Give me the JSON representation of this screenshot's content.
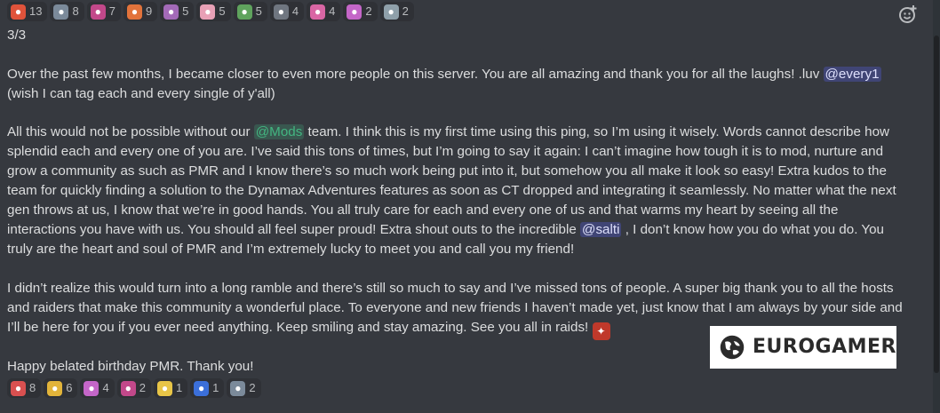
{
  "reactions_top": [
    {
      "emoji": "angry-face-icon",
      "count": "13",
      "color": "#e0533b"
    },
    {
      "emoji": "ghost-pokemon-icon",
      "count": "8",
      "color": "#7b8a9a"
    },
    {
      "emoji": "dragon-pokemon-icon",
      "count": "7",
      "color": "#c2488a"
    },
    {
      "emoji": "fire-pokemon-icon",
      "count": "9",
      "color": "#e2733b"
    },
    {
      "emoji": "bird-pokemon-icon",
      "count": "5",
      "color": "#a36ab8"
    },
    {
      "emoji": "fairy-pokemon-icon",
      "count": "5",
      "color": "#e8a0b6"
    },
    {
      "emoji": "bug-pokemon-icon",
      "count": "5",
      "color": "#5fa35d"
    },
    {
      "emoji": "heart-outline-icon",
      "count": "4",
      "color": "#6f7680"
    },
    {
      "emoji": "pink-pokemon-icon",
      "count": "4",
      "color": "#d966a4"
    },
    {
      "emoji": "psychic-pokemon-icon",
      "count": "2",
      "color": "#c466c8"
    },
    {
      "emoji": "robot-pokemon-icon",
      "count": "2",
      "color": "#8fa0aa"
    }
  ],
  "reactions_bottom": [
    {
      "emoji": "pokeball-icon",
      "count": "8",
      "color": "#d95050"
    },
    {
      "emoji": "pikachu-icon",
      "count": "6",
      "color": "#e2b43a"
    },
    {
      "emoji": "psychic-pokemon-icon",
      "count": "4",
      "color": "#c466c8"
    },
    {
      "emoji": "dragon-pokemon-icon",
      "count": "2",
      "color": "#c2488a"
    },
    {
      "emoji": "electric-pokemon-icon",
      "count": "1",
      "color": "#e8c547"
    },
    {
      "emoji": "shield-icon",
      "count": "1",
      "color": "#3b6fd9"
    },
    {
      "emoji": "ghost-pokemon-icon",
      "count": "2",
      "color": "#7b8a9a"
    }
  ],
  "message": {
    "header": "3/3",
    "p1_a": "Over the past few months, I became closer to even more people on this server. You are all amazing and thank you for all the laughs! .luv ",
    "p1_mention": "@every1",
    "p1_b": " (wish I can tag each and every single of y'all)",
    "p2_a": "All this would not be possible without our ",
    "p2_mention1": "@Mods",
    "p2_b": " team. I think this is my first time using this ping, so I’m using it wisely. Words cannot describe how splendid each and every one of you are. I’ve said this tons of times, but I’m going to say it again: I can’t imagine how tough it is to mod, nurture and grow a community as such as PMR and I know there’s so much work being put into it, but somehow you all make it look so easy! Extra kudos to the team for quickly finding a solution to the Dynamax Adventures features as soon as CT dropped and integrating it seamlessly. No matter what the next gen throws at us, I know that we’re in good hands. You all truly care for each and every one of us and that warms my heart by seeing all the interactions you have with us. You should all feel super proud! Extra shout outs to the incredible ",
    "p2_mention2": "@salti",
    "p2_c": " , I don’t know how you do what you do. You truly are the heart and soul of PMR and I’m extremely lucky to meet you and call you my friend!",
    "p3": "I didn’t realize this would turn into a long ramble and there’s still so much to say and I’ve missed tons of people. A super big thank you to all the hosts and raiders that make this community a wonderful place. To everyone and new friends I haven’t made yet, just know that I am always by your side and I’ll be here for you if you ever need anything. Keep smiling and stay amazing. See you all in raids! ",
    "p4": "Happy belated birthday PMR. Thank you!"
  },
  "watermark": {
    "text": "EUROGAMER"
  },
  "add_reaction_icon": "add-reaction-icon"
}
